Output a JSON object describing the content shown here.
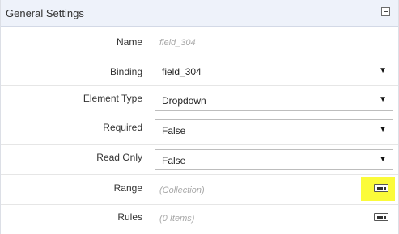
{
  "header": {
    "title": "General Settings"
  },
  "rows": {
    "name": {
      "label": "Name",
      "value": "field_304"
    },
    "binding": {
      "label": "Binding",
      "value": "field_304"
    },
    "element_type": {
      "label": "Element Type",
      "value": "Dropdown"
    },
    "required": {
      "label": "Required",
      "value": "False"
    },
    "read_only": {
      "label": "Read Only",
      "value": "False"
    },
    "range": {
      "label": "Range",
      "value": "(Collection)"
    },
    "rules": {
      "label": "Rules",
      "value": "(0 Items)"
    }
  },
  "icons": {
    "collapse": "minus-square-icon",
    "ellipsis": "ellipsis-icon",
    "dropdown": "triangle-down-icon"
  },
  "colors": {
    "highlight": "#fbfb3a",
    "header_bg": "#eef2fa"
  },
  "glyphs": {
    "dropdown_arrow": "▼"
  }
}
